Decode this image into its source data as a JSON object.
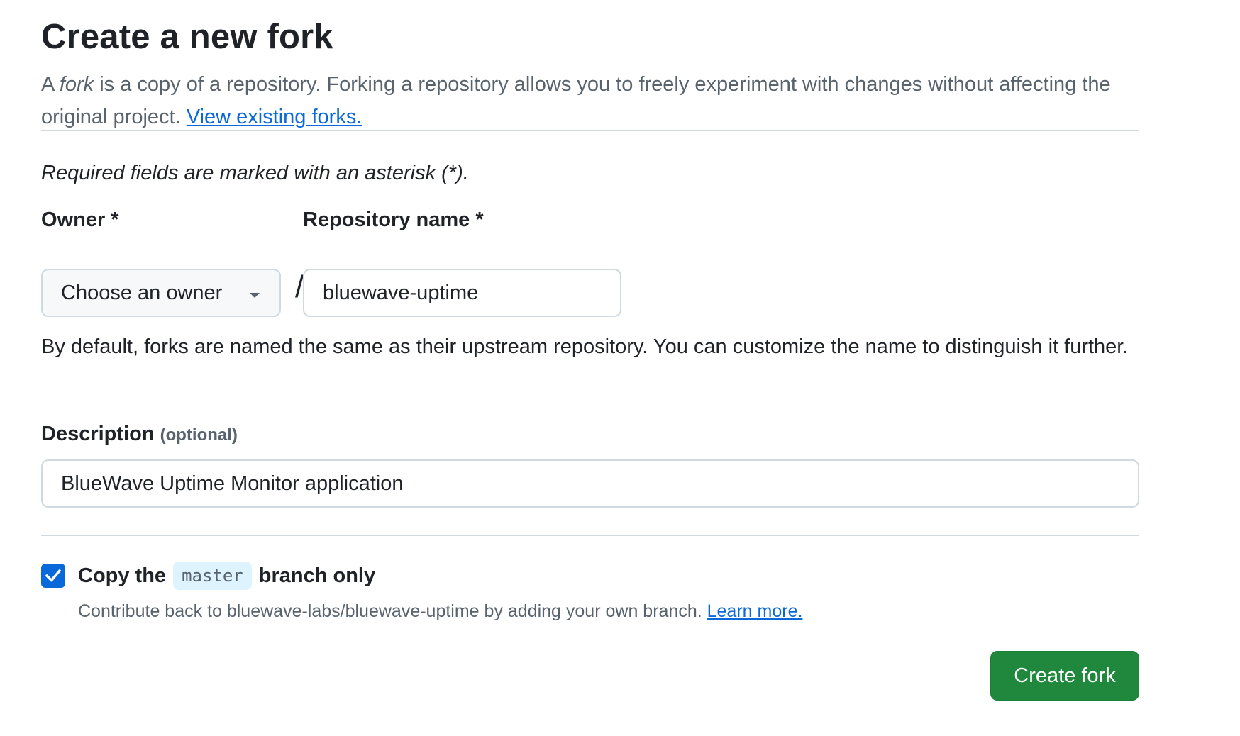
{
  "page": {
    "title": "Create a new fork",
    "intro_prefix": "A ",
    "intro_italic": "fork",
    "intro_rest": " is a copy of a repository. Forking a repository allows you to freely experiment with changes without affecting the original project. ",
    "view_forks_link": "View existing forks.",
    "required_note": "Required fields are marked with an asterisk (*)."
  },
  "form": {
    "owner": {
      "label": "Owner *",
      "selected": "Choose an owner"
    },
    "separator": "/",
    "repo_name": {
      "label": "Repository name *",
      "value": "bluewave-uptime"
    },
    "name_hint": "By default, forks are named the same as their upstream repository. You can customize the name to distinguish it further.",
    "description": {
      "label": "Description",
      "optional": "(optional)",
      "value": "BlueWave Uptime Monitor application"
    },
    "copy_branch": {
      "checked": true,
      "label_prefix": "Copy the",
      "branch": "master",
      "label_suffix": "branch only",
      "sub_text": "Contribute back to bluewave-labs/bluewave-uptime by adding your own branch. ",
      "learn_more": "Learn more."
    },
    "submit_label": "Create fork"
  },
  "colors": {
    "primary_blue": "#0969da",
    "create_green": "#1f883d",
    "muted_text": "#59636e",
    "border": "#d1d9e0"
  }
}
